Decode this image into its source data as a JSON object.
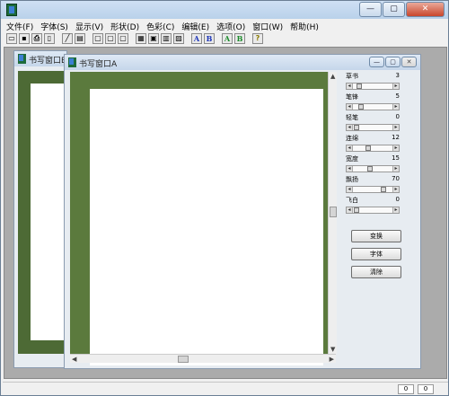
{
  "menu": [
    "文件(F)",
    "字体(S)",
    "显示(V)",
    "形状(D)",
    "色彩(C)",
    "编辑(E)",
    "选项(O)",
    "窗口(W)",
    "帮助(H)"
  ],
  "toolbar": {
    "a_blue": "A",
    "b_blue": "B",
    "a_green": "A",
    "b_green": "B"
  },
  "window_b": {
    "title": "书写窗口B"
  },
  "window_a": {
    "title": "书写窗口A"
  },
  "controls": [
    {
      "label": "草书",
      "value": "3",
      "pos": 0.1
    },
    {
      "label": "笔锋",
      "value": "5",
      "pos": 0.16
    },
    {
      "label": "轻笔",
      "value": "0",
      "pos": 0.02
    },
    {
      "label": "连绵",
      "value": "12",
      "pos": 0.35
    },
    {
      "label": "宽度",
      "value": "15",
      "pos": 0.4
    },
    {
      "label": "飘扬",
      "value": "70",
      "pos": 0.78
    },
    {
      "label": "飞白",
      "value": "0",
      "pos": 0.02
    }
  ],
  "buttons": {
    "transform": "变换",
    "font": "字体",
    "clear": "清除"
  },
  "status": {
    "cell1": "0",
    "cell2": "0"
  },
  "colors": {
    "canvas_green": "#5b7a3d",
    "paper": "#ffffff"
  }
}
